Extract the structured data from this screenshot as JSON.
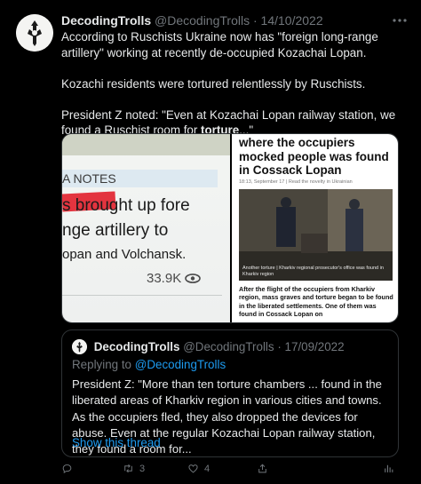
{
  "tweet": {
    "name": "DecodingTrolls",
    "handle": "@DecodingTrolls",
    "separator": "·",
    "date": "14/10/2022",
    "more_icon": "more-dots-icon",
    "paragraphs": {
      "p1": "According to Ruschists Ukraine now has \"foreign long-range artillery\" working at recently de-occupied Kozachai Lopan.",
      "p2": "Kozachi residents were tortured relentlessly by Ruschists.",
      "p3_prefix": "President Z noted: \"Even at Kozachai Lopan railway station, we found a Ruschist room for ",
      "p3_bold": "torture",
      "p3_suffix": "...\""
    }
  },
  "media": {
    "left": {
      "notes_label": "A NOTES",
      "line1": "s brought up fore",
      "line2": "nge artillery to",
      "line3": "opan and Volchansk.",
      "views": "33.9K"
    },
    "right": {
      "headline": "where the occupiers mocked people was found in Cossack Lopan",
      "meta": "18:13, September 17  |  Read the novelty in Ukrainian",
      "photo_caption": "Another torture | Kharkiv regional prosecutor's office was found in Kharkiv region",
      "lede": "After the flight of the occupiers from Kharkiv region, mass graves and torture began to be found in the liberated settlements. One of them was found in Cossack Lopan on"
    }
  },
  "quote": {
    "name": "DecodingTrolls",
    "handle": "@DecodingTrolls",
    "separator": "·",
    "date": "17/09/2022",
    "replying_label": "Replying to",
    "replying_handle": "@DecodingTrolls",
    "text": "President Z: \"More than ten torture chambers ... found in the liberated areas of Kharkiv region in various cities and towns. As the occupiers fled, they also dropped the devices for abuse. Even at the regular Kozachai Lopan railway station, they found a room for...",
    "show_thread": "Show this thread"
  },
  "actions": {
    "reply_icon": "reply-icon",
    "retweet_icon": "retweet-icon",
    "retweet_count": "3",
    "like_icon": "heart-icon",
    "like_count": "4",
    "share_icon": "share-icon",
    "analytics_icon": "analytics-icon"
  },
  "colors": {
    "background": "#000000",
    "text": "#e7e9ea",
    "muted": "#71767b",
    "accent": "#1d9bf0",
    "border": "#2f3336"
  }
}
